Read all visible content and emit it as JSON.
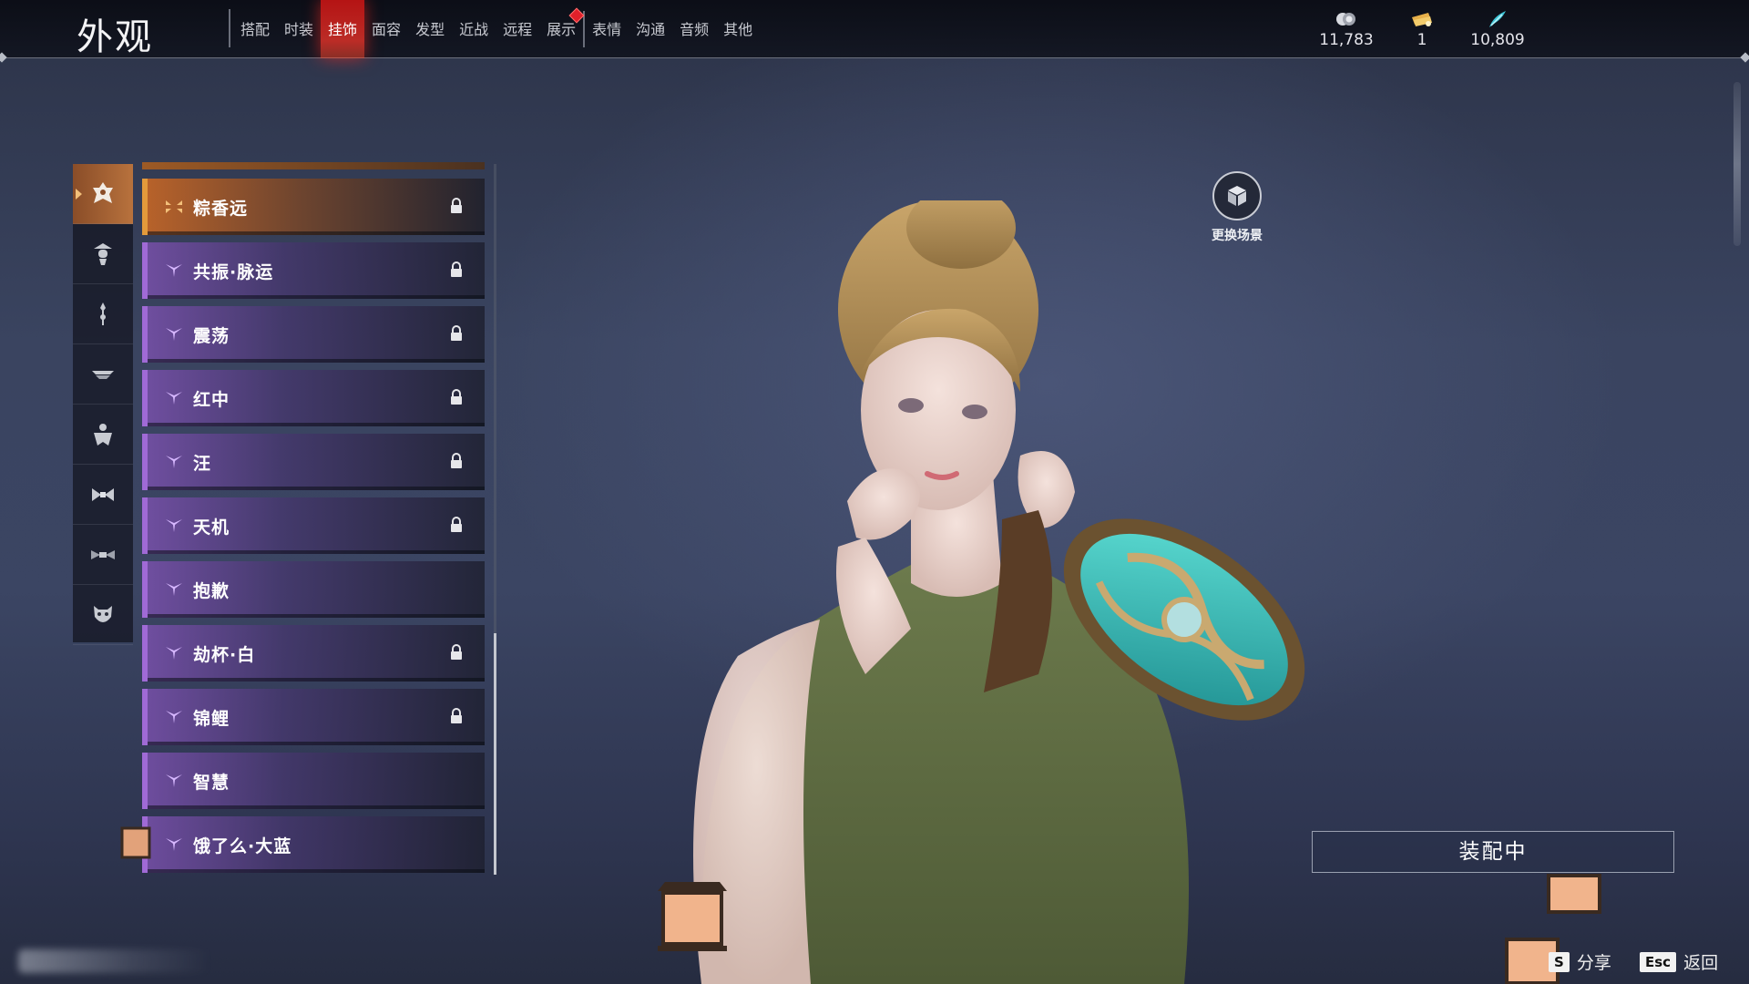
{
  "header": {
    "title": "外观",
    "tabs": [
      {
        "label": "搭配",
        "active": false
      },
      {
        "label": "时装",
        "active": false
      },
      {
        "label": "挂饰",
        "active": true
      },
      {
        "label": "面容",
        "active": false
      },
      {
        "label": "发型",
        "active": false
      },
      {
        "label": "近战",
        "active": false
      },
      {
        "label": "远程",
        "active": false
      },
      {
        "label": "展示",
        "active": false,
        "badge": true
      },
      {
        "label": "表情",
        "active": false
      },
      {
        "label": "沟通",
        "active": false
      },
      {
        "label": "音频",
        "active": false
      },
      {
        "label": "其他",
        "active": false
      }
    ],
    "currencies": [
      {
        "icon": "coin-stack-icon",
        "value": "11,783"
      },
      {
        "icon": "ticket-icon",
        "value": "1"
      },
      {
        "icon": "feather-icon",
        "value": "10,809"
      }
    ]
  },
  "categories": [
    {
      "icon": "mask-ornament-icon",
      "active": true
    },
    {
      "icon": "hat-figure-icon",
      "active": false
    },
    {
      "icon": "hairpin-icon",
      "active": false
    },
    {
      "icon": "headband-icon",
      "active": false
    },
    {
      "icon": "cape-icon",
      "active": false
    },
    {
      "icon": "bow-icon",
      "active": false
    },
    {
      "icon": "waist-ornament-icon",
      "active": false
    },
    {
      "icon": "demon-mask-icon",
      "active": false
    }
  ],
  "items": [
    {
      "name": "粽香远",
      "rarity": "gold",
      "locked": true
    },
    {
      "name": "共振·脉运",
      "rarity": "purple",
      "locked": true
    },
    {
      "name": "震荡",
      "rarity": "purple",
      "locked": true
    },
    {
      "name": "红中",
      "rarity": "purple",
      "locked": true
    },
    {
      "name": "汪",
      "rarity": "purple",
      "locked": true
    },
    {
      "name": "天机",
      "rarity": "purple",
      "locked": true
    },
    {
      "name": "抱歉",
      "rarity": "purple",
      "locked": false
    },
    {
      "name": "劫杯·白",
      "rarity": "purple",
      "locked": true
    },
    {
      "name": "锦鲤",
      "rarity": "purple",
      "locked": true
    },
    {
      "name": "智慧",
      "rarity": "purple",
      "locked": false
    },
    {
      "name": "饿了么·大蓝",
      "rarity": "purple",
      "locked": false
    }
  ],
  "scene": {
    "label": "更换场景",
    "icon": "cube-icon"
  },
  "equip": {
    "label": "装配中"
  },
  "hints": [
    {
      "key": "S",
      "label": "分享"
    },
    {
      "key": "Esc",
      "label": "返回"
    }
  ],
  "colors": {
    "tab_active": "#d8211e",
    "rarity_gold": "#e39a3b",
    "rarity_purple": "#a06ad6",
    "currency_feather": "#3fc6d8"
  }
}
